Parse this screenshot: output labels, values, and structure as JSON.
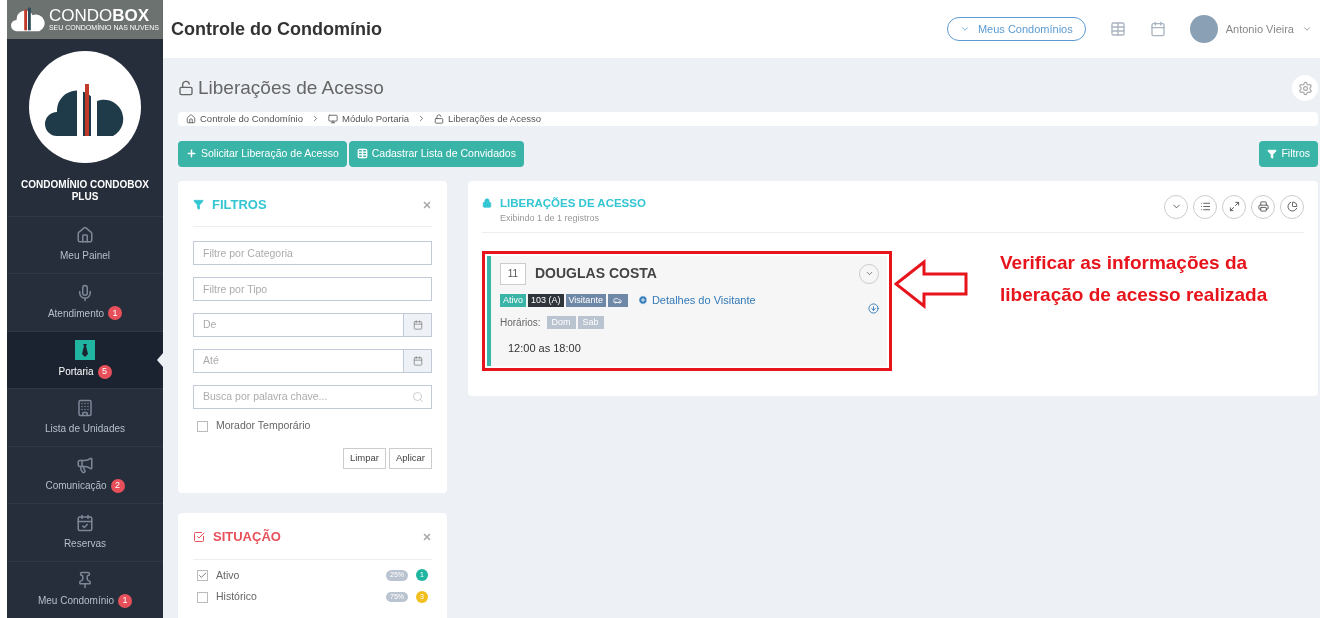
{
  "brand": {
    "name_light": "CONDO",
    "name_bold": "BOX",
    "tagline": "SEU CONDOMÍNIO NAS NUVENS"
  },
  "header": {
    "title": "Controle do Condomínio",
    "condos_button": "Meus Condomínios",
    "user": "Antonio Vieira"
  },
  "sidebar": {
    "condo_name": "CONDOMÍNIO CONDOBOX PLUS",
    "items": [
      {
        "label": "Meu Painel",
        "selected": false
      },
      {
        "label": "Atendimento",
        "badge": "1",
        "selected": false
      },
      {
        "label": "Portaria",
        "badge": "5",
        "selected": true
      },
      {
        "label": "Lista de Unidades",
        "selected": false
      },
      {
        "label": "Comunicação",
        "badge": "2",
        "selected": false
      },
      {
        "label": "Reservas",
        "selected": false
      },
      {
        "label": "Meu Condomínio",
        "badge": "1",
        "selected": false
      }
    ]
  },
  "page": {
    "title": "Liberações de Acesso",
    "breadcrumb": [
      "Controle do Condomínio",
      "Módulo Portaria",
      "Liberações de Acesso"
    ],
    "actions": [
      "Solicitar Liberação de Acesso",
      "Cadastrar Lista de Convidados"
    ],
    "filters_button": "Filtros"
  },
  "filters": {
    "title": "FILTROS",
    "fields": [
      {
        "kind": "text",
        "placeholder": "Filtre por Categoria"
      },
      {
        "kind": "text",
        "placeholder": "Filtre por Tipo"
      },
      {
        "kind": "date",
        "placeholder": "De"
      },
      {
        "kind": "date",
        "placeholder": "Até"
      },
      {
        "kind": "search",
        "placeholder": "Busca por palavra chave..."
      }
    ],
    "temp_resident": {
      "label": "Morador Temporário",
      "checked": false
    },
    "buttons": [
      "Limpar",
      "Aplicar"
    ]
  },
  "situation": {
    "title": "SITUAÇÃO",
    "items": [
      {
        "label": "Ativo",
        "checked": true,
        "percent": "25%",
        "count": "1",
        "color": "#1fb5a1"
      },
      {
        "label": "Histórico",
        "checked": false,
        "percent": "75%",
        "count": "3",
        "color": "#f2c01e"
      }
    ]
  },
  "list": {
    "title": "LIBERAÇÕES DE ACESSO",
    "subtitle": "Exibindo 1 de 1 registros",
    "records": [
      {
        "number": "11",
        "name": "DOUGLAS COSTA",
        "tags": [
          {
            "kind": "status",
            "text": "Ativo"
          },
          {
            "kind": "unit",
            "text": "103 (A)"
          },
          {
            "kind": "type",
            "text": "Visitante"
          },
          {
            "kind": "car"
          }
        ],
        "details_link": "Detalhes do Visitante",
        "schedule_label": "Horários:",
        "days": [
          "Dom",
          "Sab"
        ],
        "hours": "12:00 as 18:00"
      }
    ]
  },
  "annotation": "Verificar as informações da liberação de acesso realizada"
}
